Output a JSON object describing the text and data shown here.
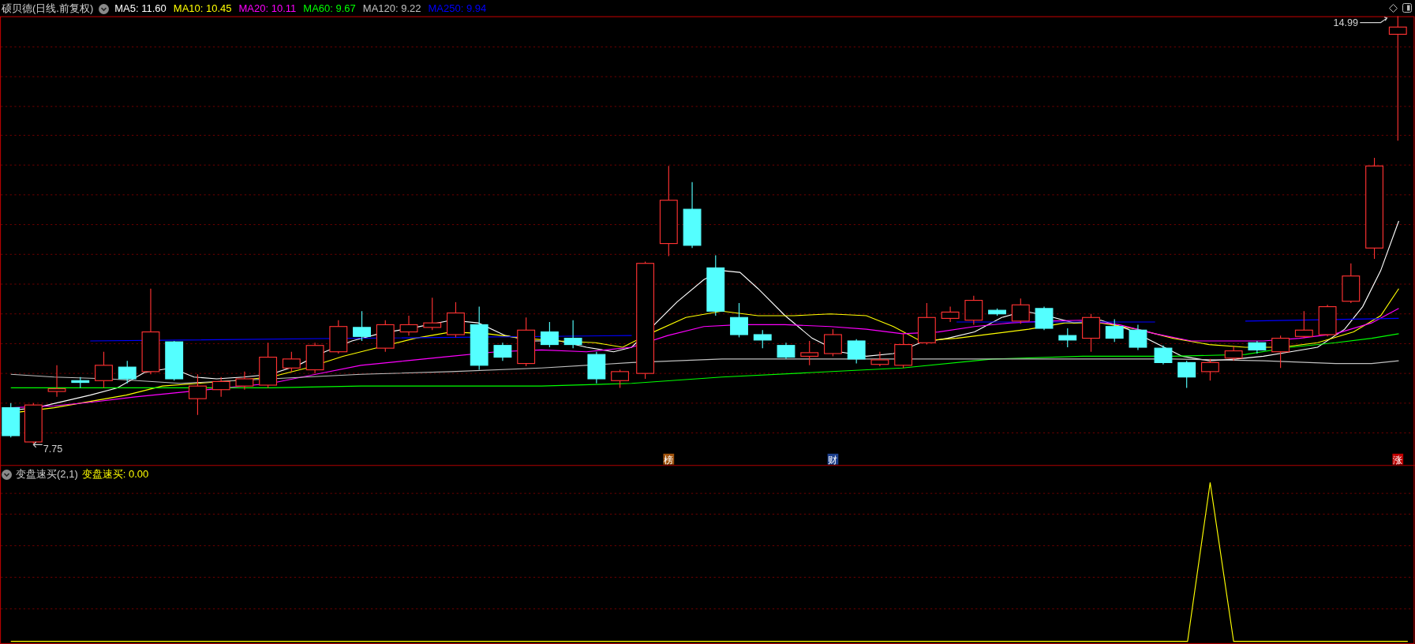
{
  "price_panel": {
    "title": "硕贝德(日线.前复权)",
    "moving_averages": [
      {
        "label": "MA5: 11.60",
        "color": "#ffffff"
      },
      {
        "label": "MA10: 10.45",
        "color": "#ffff00"
      },
      {
        "label": "MA20: 10.11",
        "color": "#ff00ff"
      },
      {
        "label": "MA60: 9.67",
        "color": "#00ff00"
      },
      {
        "label": "MA120: 9.22",
        "color": "#c0c0c0"
      },
      {
        "label": "MA250: 9.94",
        "color": "#0000ff"
      }
    ],
    "high_label": "14.99",
    "low_label": "7.75",
    "event_tags": [
      {
        "text": "榜",
        "color": "#a0520c"
      },
      {
        "text": "财",
        "color": "#1c3f8c"
      },
      {
        "text": "涨",
        "color": "#c00000"
      }
    ]
  },
  "indicator_panel": {
    "title": "变盘速买(2,1)",
    "value": "变盘速买: 0.00"
  }
}
